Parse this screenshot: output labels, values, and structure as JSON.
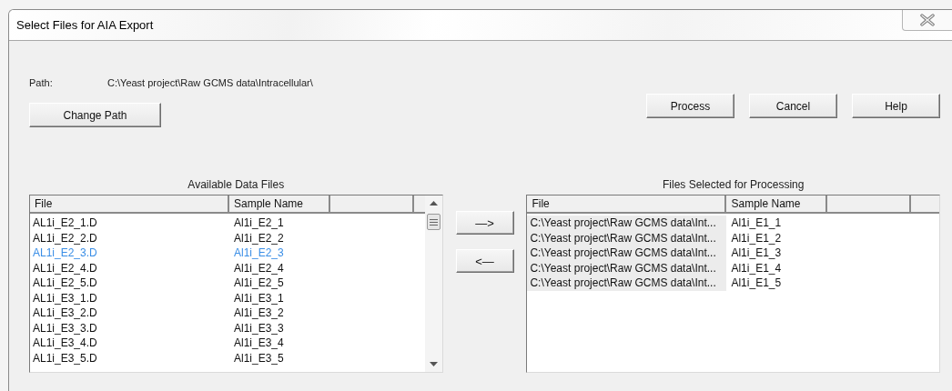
{
  "window": {
    "title": "Select Files for AIA Export"
  },
  "path": {
    "label": "Path:",
    "value": "C:\\Yeast project\\Raw GCMS data\\Intracellular\\"
  },
  "change_path_button": "Change Path",
  "action_buttons": [
    "Process",
    "Cancel",
    "Help"
  ],
  "available": {
    "heading": "Available Data Files",
    "columns": [
      "File",
      "Sample Name"
    ],
    "rows": [
      {
        "file": "AL1i_E2_1.D",
        "sample": "Al1i_E2_1",
        "selected": false
      },
      {
        "file": "AL1i_E2_2.D",
        "sample": "Al1i_E2_2",
        "selected": false
      },
      {
        "file": "AL1i_E2_3.D",
        "sample": "Al1i_E2_3",
        "selected": true
      },
      {
        "file": "AL1i_E2_4.D",
        "sample": "Al1i_E2_4",
        "selected": false
      },
      {
        "file": "AL1i_E2_5.D",
        "sample": "Al1i_E2_5",
        "selected": false
      },
      {
        "file": "AL1i_E3_1.D",
        "sample": "Al1i_E3_1",
        "selected": false
      },
      {
        "file": "AL1i_E3_2.D",
        "sample": "Al1i_E3_2",
        "selected": false
      },
      {
        "file": "AL1i_E3_3.D",
        "sample": "Al1i_E3_3",
        "selected": false
      },
      {
        "file": "AL1i_E3_4.D",
        "sample": "Al1i_E3_4",
        "selected": false
      },
      {
        "file": "AL1i_E3_5.D",
        "sample": "Al1i_E3_5",
        "selected": false
      }
    ]
  },
  "transfer_buttons": [
    "—>",
    "<—"
  ],
  "selected_files": {
    "heading": "Files Selected for Processing",
    "columns": [
      "File",
      "Sample Name"
    ],
    "rows": [
      {
        "file": "C:\\Yeast project\\Raw GCMS data\\Int...",
        "sample": "Al1i_E1_1"
      },
      {
        "file": "C:\\Yeast project\\Raw GCMS data\\Int...",
        "sample": "Al1i_E1_2"
      },
      {
        "file": "C:\\Yeast project\\Raw GCMS data\\Int...",
        "sample": "Al1i_E1_3"
      },
      {
        "file": "C:\\Yeast project\\Raw GCMS data\\Int...",
        "sample": "Al1i_E1_4"
      },
      {
        "file": "C:\\Yeast project\\Raw GCMS data\\Int...",
        "sample": "Al1i_E1_5"
      }
    ]
  }
}
